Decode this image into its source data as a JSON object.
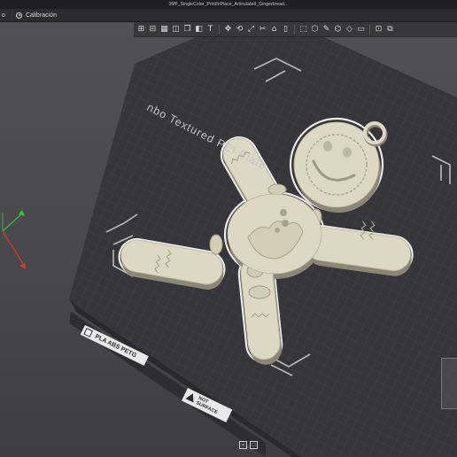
{
  "titlebar": {
    "title": "3MF_SingleColor_PrintInPlace_Articulated_Gingerbread..."
  },
  "tabs": [
    {
      "label": "o"
    },
    {
      "label": "Calibración"
    }
  ],
  "toolbar": {
    "icons": [
      "add-plate-icon",
      "orient-icon",
      "arrange-icon",
      "split-icon",
      "copy-icon",
      "layers-icon",
      "text-icon",
      "move-icon",
      "rotate-icon",
      "scale-icon",
      "cut-icon",
      "mesh-icon",
      "support-icon",
      "seam-icon",
      "paint-icon",
      "measure-icon",
      "assembly-icon",
      "view-icon",
      "fit-icon",
      "more-icon"
    ]
  },
  "bed": {
    "plate_label": "nbo Textured PEI Plate",
    "material_sticker": "PLA ABS PETG",
    "surface_sticker_line1": "NOT",
    "surface_sticker_line2": "SURFACE"
  },
  "colors": {
    "model": "#ddd8c3",
    "model_shadow": "#8b8675",
    "bed": "#3a3a3f",
    "grid": "#4a4a50",
    "axis_x": "#d23a2a",
    "axis_y": "#3ac23a",
    "outline": "#ffffff"
  }
}
